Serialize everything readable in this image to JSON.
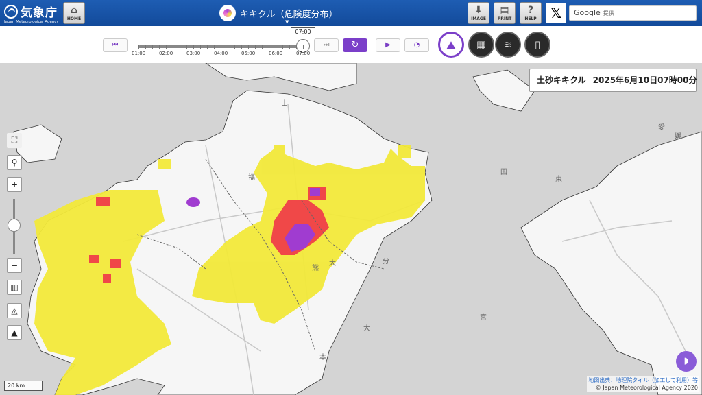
{
  "header": {
    "logo_name": "気象庁",
    "logo_en": "Japan Meteorological Agency",
    "home_label": "HOME",
    "title": "キキクル（危険度分布）",
    "image_label": "IMAGE",
    "print_label": "PRINT",
    "help_label": "HELP",
    "x_label": "𝕏",
    "search_label": "Google",
    "search_sub": "提供"
  },
  "controls": {
    "current_time": "07:00",
    "ticks": [
      "01:00",
      "02:00",
      "03:00",
      "04:00",
      "05:00",
      "06:00",
      "07:00"
    ],
    "slider_position": 1.0
  },
  "map": {
    "datetime_title": "土砂キキクル",
    "datetime_value": "2025年6月10日07時00分",
    "scale": "20 km",
    "attribution_source": "地図出典：地理院タイル（加工して利用）等",
    "attribution_copy": "© Japan Meteorological Agency 2020",
    "place_labels": [
      "福",
      "熊",
      "分",
      "大",
      "本",
      "大",
      "宮",
      "愛",
      "媛",
      "国",
      "東",
      "山"
    ]
  },
  "colors": {
    "header_blue": "#1a56ad",
    "accent_purple": "#7b3fc9",
    "warn_yellow": "#f2e93a",
    "warn_red": "#f04848",
    "warn_purple": "#a03cd0",
    "land": "#f6f6f6",
    "sea": "#d4d4d4"
  }
}
